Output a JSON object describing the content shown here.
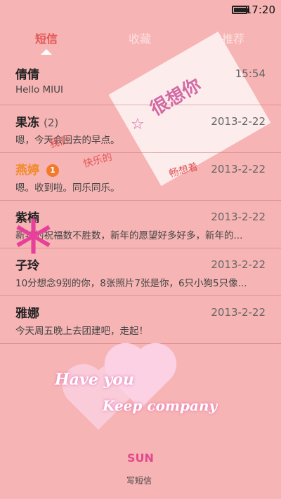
{
  "status": {
    "time": "17:20",
    "battery_level": 0.9
  },
  "tabs": [
    {
      "label": "短信",
      "active": true
    },
    {
      "label": "收藏",
      "active": false
    },
    {
      "label": "推荐",
      "active": false
    }
  ],
  "conversations": [
    {
      "name": "倩倩",
      "count": "",
      "badge": "",
      "date": "15:54",
      "preview": "Hello MIUI"
    },
    {
      "name": "果冻",
      "count": "(2)",
      "badge": "",
      "date": "2013-2-22",
      "preview": "嗯，今天会回去的早点。"
    },
    {
      "name": "燕婷",
      "count": "",
      "badge": "1",
      "date": "2013-2-22",
      "preview": "嗯。收到啦。同乐同乐。"
    },
    {
      "name": "紫楠",
      "count": "",
      "badge": "",
      "date": "2013-2-22",
      "preview": "新年的祝福数不胜数，新年的愿望好多好多，新年的..."
    },
    {
      "name": "子玲",
      "count": "",
      "badge": "",
      "date": "2013-2-22",
      "preview": "10分想念9别的你，8张照片7张是你，6只小狗5只像..."
    },
    {
      "name": "雅娜",
      "count": "",
      "badge": "",
      "date": "2013-2-22",
      "preview": "今天周五晚上去团建吧，走起！"
    }
  ],
  "theme": {
    "sticker_texts": [
      "我们",
      "快乐的",
      "畅想着",
      "很想你"
    ],
    "script_line1": "Have you",
    "script_line2": "Keep company",
    "sun_text": "SUN",
    "accent": "#e25555"
  },
  "compose_label": "写短信"
}
